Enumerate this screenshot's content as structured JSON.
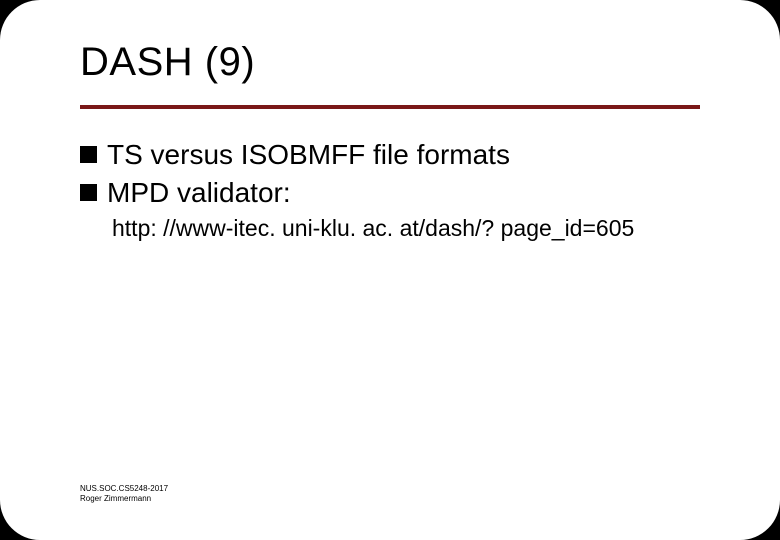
{
  "title": "DASH (9)",
  "bullets": [
    {
      "text": "TS versus ISOBMFF file formats"
    },
    {
      "text": "MPD validator:"
    }
  ],
  "sublink": "http: //www-itec. uni-klu. ac. at/dash/? page_id=605",
  "footer": {
    "line1": "NUS.SOC.CS5248-2017",
    "line2": "Roger Zimmermann"
  }
}
